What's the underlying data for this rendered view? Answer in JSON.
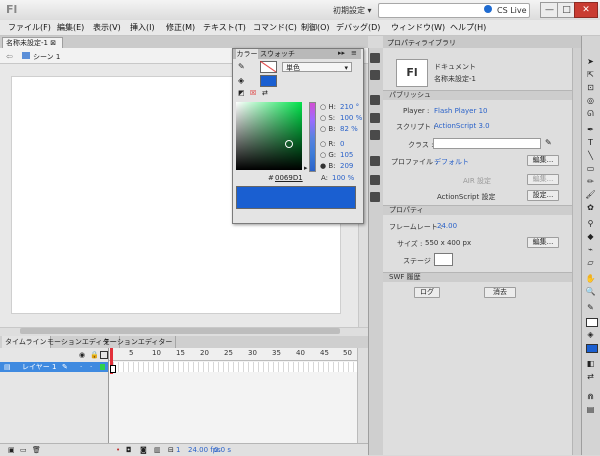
{
  "app": {
    "logo": "Fl",
    "workspace": "初期設定 ▾",
    "search_label": "CS Live",
    "window_buttons": {
      "minimize": "—",
      "maximize": "□",
      "close": "✕"
    }
  },
  "menu": [
    "ファイル(F)",
    "編集(E)",
    "表示(V)",
    "挿入(I)",
    "修正(M)",
    "テキスト(T)",
    "コマンド(C)",
    "制御(O)",
    "デバッグ(D)",
    "ウィンドウ(W)",
    "ヘルプ(H)"
  ],
  "document": {
    "tab_label": "名称未設定-1 ⊠",
    "scene_label": "シーン 1"
  },
  "timeline": {
    "tabs": [
      "タイムライン",
      "モーションエディター",
      "モーションエディター"
    ],
    "frame_numbers": [
      "5",
      "10",
      "15",
      "20",
      "25",
      "30",
      "35",
      "40",
      "45",
      "50"
    ],
    "layer_name": "レイヤー 1",
    "status": {
      "fps": "24.00 fps",
      "time": "0.0 s",
      "frame": "1"
    }
  },
  "color_panel": {
    "tabs": [
      "カラー",
      "スウォッチ"
    ],
    "fill_type": "単色",
    "hue": "210 °",
    "saturation": "100 %",
    "brightness": "82 %",
    "r": "0",
    "g": "105",
    "b": "209",
    "hex": "0069D1",
    "alpha": "100 %",
    "preview_color": "#1a5fd1"
  },
  "properties": {
    "tabs": [
      "プロパティ",
      "ライブラリ"
    ],
    "doc_type": "ドキュメント",
    "doc_name": "名称未設定-1",
    "publish_section": "パブリッシュ",
    "player_label": "Player :",
    "player_value": "Flash Player 10",
    "script_label": "スクリプト :",
    "script_value": "ActionScript 3.0",
    "class_label": "クラス :",
    "profile_label": "プロファイル :",
    "profile_value": "デフォルト",
    "air_label": "AIR 設定",
    "as_label": "ActionScript 設定",
    "edit_button": "編集...",
    "settings_button": "設定...",
    "props_section": "プロパティ",
    "fps_label": "フレームレート :",
    "fps_value": "24.00",
    "size_label": "サイズ :",
    "size_value": "550 x 400 px",
    "stage_label": "ステージ :",
    "swf_section": "SWF 履歴",
    "log_button": "ログ",
    "clear_button": "消去"
  }
}
